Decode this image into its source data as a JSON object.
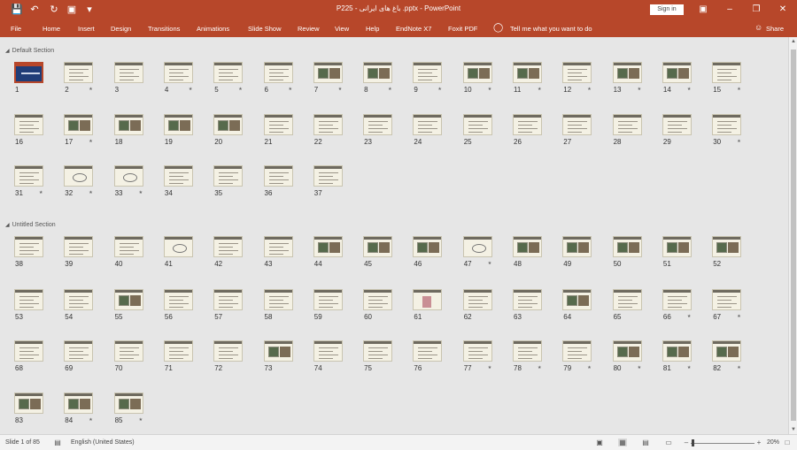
{
  "window": {
    "title": "P225 - باغ های ایرانی .pptx - PowerPoint",
    "sign_in": "Sign in"
  },
  "ribbon": {
    "tabs": [
      "File",
      "Home",
      "Insert",
      "Design",
      "Transitions",
      "Animations",
      "Slide Show",
      "Review",
      "View",
      "Help",
      "EndNote X7",
      "Foxit PDF"
    ],
    "tell_me": "Tell me what you want to do",
    "share": "Share"
  },
  "sections": [
    {
      "name": "Default Section",
      "first": 1,
      "last": 37
    },
    {
      "name": "Untitled Section",
      "first": 38,
      "last": 85
    }
  ],
  "slides": {
    "selected": 1,
    "starred": [
      2,
      4,
      5,
      6,
      7,
      8,
      9,
      10,
      11,
      12,
      13,
      14,
      15,
      17,
      30,
      31,
      32,
      33,
      47,
      66,
      67,
      77,
      78,
      79,
      80,
      81,
      82,
      84,
      85
    ],
    "photo_slides": [
      7,
      8,
      10,
      11,
      13,
      14,
      17,
      18,
      19,
      20,
      44,
      45,
      46,
      48,
      49,
      50,
      51,
      52,
      55,
      64,
      73,
      80,
      81,
      82,
      83,
      84,
      85
    ],
    "diagram_slides": [
      32,
      33,
      41,
      47
    ],
    "red_slides": [
      61
    ]
  },
  "status": {
    "slide_info": "Slide 1 of 85",
    "language": "English (United States)",
    "zoom": "20%"
  },
  "colors": {
    "accent": "#b7472a",
    "selection": "#b7472a"
  }
}
